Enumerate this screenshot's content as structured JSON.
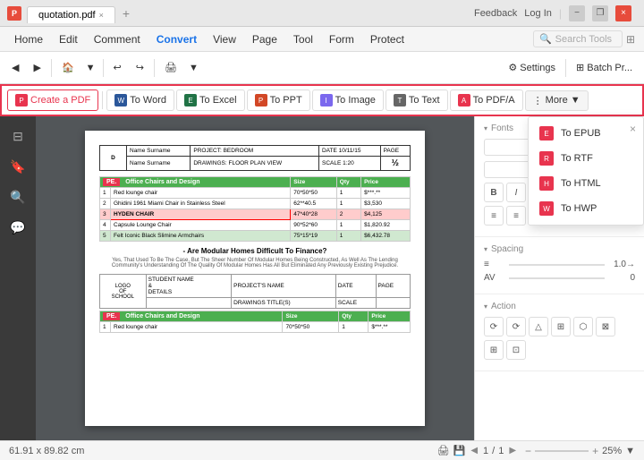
{
  "titlebar": {
    "filename": "quotation.pdf",
    "close_icon": "×",
    "minimize_icon": "−",
    "maximize_icon": "□",
    "restore_icon": "❐",
    "feedback": "Feedback",
    "login": "Log In"
  },
  "menubar": {
    "items": [
      "Home",
      "Edit",
      "Comment",
      "Convert",
      "View",
      "Page",
      "Tool",
      "Form",
      "Protect"
    ]
  },
  "toolbar": {
    "search_placeholder": "Search Tools",
    "settings_label": "Settings",
    "batch_label": "Batch Pr..."
  },
  "convert_toolbar": {
    "create_pdf": "Create a PDF",
    "to_word": "To Word",
    "to_excel": "To Excel",
    "to_ppt": "To PPT",
    "to_image": "To Image",
    "to_text": "To Text",
    "to_pdfa": "To PDF/A",
    "more": "More"
  },
  "dropdown": {
    "items": [
      "To EPUB",
      "To RTF",
      "To HTML",
      "To HWP"
    ]
  },
  "document": {
    "big_letter": "D",
    "header": {
      "name_surname": "Name Surname",
      "project": "PROJECT: BEDROOM",
      "date": "DATE 10/11/15",
      "page_label": "PAGE",
      "page_value": "½",
      "name_surname2": "Name Surname",
      "drawings": "DRAWINGS: FLOOR PLAN VIEW",
      "scale": "SCALE 1:20"
    },
    "table": {
      "section_title": "PE.   Office Chairs and Design",
      "columns": [
        "",
        "Size",
        "Qty",
        "Price"
      ],
      "rows": [
        {
          "num": "1",
          "name": "Red lounge chair",
          "size": "70*50*50",
          "qty": "1",
          "price": "$***.**"
        },
        {
          "num": "2",
          "name": "Ghidini 1961 Miami Chair in Stainless Steel",
          "size": "62**40.5",
          "qty": "1",
          "price": "$3,530"
        },
        {
          "num": "3",
          "name": "HYDEN CHAIR",
          "size": "47*40*28",
          "qty": "2",
          "price": "$4,125"
        },
        {
          "num": "4",
          "name": "Capsule Lounge Chair",
          "size": "90*52*60",
          "qty": "1",
          "price": "$1,820.92"
        },
        {
          "num": "5",
          "name": "Felt Iconic Black Slimine Armchairs",
          "size": "75*15*19",
          "qty": "1",
          "price": "$6,432.78"
        }
      ]
    },
    "section_title": "- Are Modular Homes Difficult To Finance?",
    "section_text": "Yes, That Used To Be The Case, But The Sheer Number Of Modular Homes Being Constructed, As Well As The Lending Community's Understanding Of The Quality Of Modular Homes Has All But Eliminated Any Previously Existing Prejudice.",
    "footer_table": {
      "section_title": "PE.   Office Chairs and Design",
      "columns": [
        "",
        "Size",
        "Qty",
        "Price"
      ],
      "rows": [
        {
          "num": "1",
          "name": "Red lounge chair",
          "size": "70*50*50",
          "qty": "1",
          "price": "$***.**"
        }
      ],
      "logo_cell": "LOGO\nOF\nSCHOOL",
      "student_name": "STUDENT NAME\n&\nDETAILS",
      "projects_name": "PROJECT'S NAME",
      "drawings_title": "DRAWINGS TITLE(S)",
      "date_label": "DATE",
      "page_label": "PAGE",
      "scale_label": "SCALE"
    }
  },
  "right_panel": {
    "fonts_title": "Fonts",
    "spacing_title": "Spacing",
    "action_title": "Action",
    "av_label": "AV",
    "spacing_value": "1.0→"
  },
  "status_bar": {
    "position": "61.91 x 89.82 cm",
    "page_current": "1",
    "page_total": "1",
    "zoom_level": "25%"
  }
}
